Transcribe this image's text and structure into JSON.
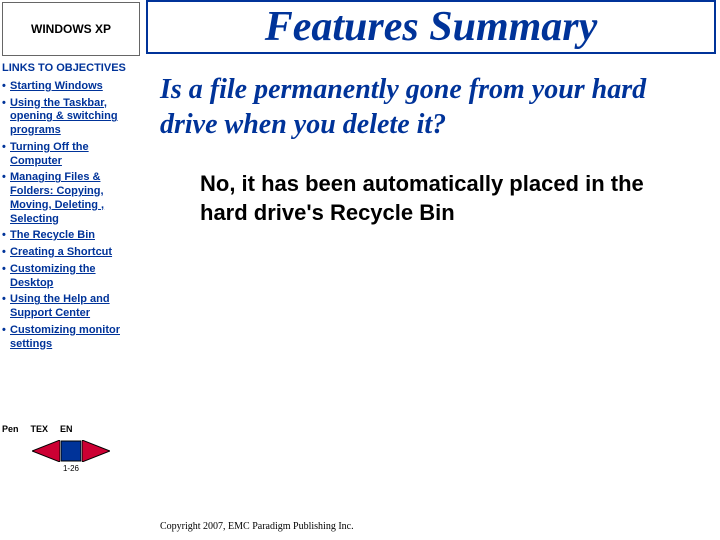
{
  "sidebar": {
    "title": "WINDOWS XP",
    "section_label": "LINKS TO OBJECTIVES",
    "items": [
      {
        "label": "Starting Windows"
      },
      {
        "label": "Using the Taskbar, opening & switching programs"
      },
      {
        "label": "Turning Off the Computer"
      },
      {
        "label": "Managing Files & Folders: Copying, Moving, Deleting , Selecting"
      },
      {
        "label": "The Recycle Bin"
      },
      {
        "label": "Creating a Shortcut"
      },
      {
        "label": "Customizing the Desktop"
      },
      {
        "label": "Using the Help and Support Center"
      },
      {
        "label": "Customizing monitor settings"
      }
    ]
  },
  "header": {
    "title": "Features Summary"
  },
  "question": "Is a file permanently gone from your hard drive when you delete it?",
  "answer": "No, it has been automatically placed in the hard drive's Recycle Bin",
  "controls": {
    "pen_label": "Pen",
    "text_label": "TEX",
    "lang_label": "EN",
    "page_label": "1-26"
  },
  "footer": {
    "copyright": "Copyright 2007, EMC Paradigm Publishing Inc."
  }
}
